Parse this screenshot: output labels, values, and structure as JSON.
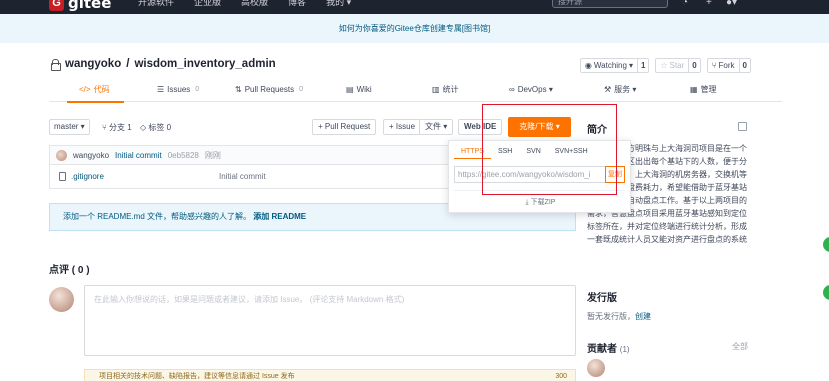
{
  "topbar": {
    "logo_text": "gitee",
    "nav": [
      "开源软件",
      "企业版",
      "高校版",
      "博客",
      "我的 ▾"
    ],
    "search_placeholder": "搜开源"
  },
  "banner": {
    "text": "如何为你喜爱的Gitee仓库创建专属[图书馆]"
  },
  "repo": {
    "owner": "wangyoko",
    "separator": "/",
    "name": "wisdom_inventory_admin",
    "watch_label": "Watching",
    "watch_count": "1",
    "star_label": "Star",
    "star_count": "0",
    "fork_label": "Fork",
    "fork_count": "0"
  },
  "tabs": [
    {
      "label": "代码",
      "icon": "code-icon"
    },
    {
      "label": "Issues",
      "badge": "0"
    },
    {
      "label": "Pull Requests",
      "badge": "0"
    },
    {
      "label": "Wiki"
    },
    {
      "label": "统计"
    },
    {
      "label": "DevOps ▾"
    },
    {
      "label": "服务 ▾"
    },
    {
      "label": "管理"
    }
  ],
  "toolbar": {
    "branch": "master ▾",
    "branches": "分支 1",
    "tags": "标签 0",
    "pull_request": "+ Pull Request",
    "issue": "+ Issue",
    "file": "文件 ▾",
    "webide": "Web IDE",
    "clone": "克隆/下载 ▾"
  },
  "commit": {
    "author": "wangyoko",
    "message": "Initial commit",
    "sha": "0eb5828",
    "time": "刚刚"
  },
  "files": [
    {
      "name": ".gitignore",
      "message": "Initial commit"
    }
  ],
  "readme_notice": {
    "text": "添加一个 README.md 文件，帮助感兴趣的人了解。",
    "action": "添加 README"
  },
  "comments": {
    "title": "点评 ( 0 )",
    "placeholder": "在此输入你想说的话，如果是问题或者建议，请添加 Issue。 (评论支持 Markdown 格式)",
    "notice": "项目相关的技术问题、缺陷报告，建议等信息请通过 Issue 发布",
    "notice_count": "300"
  },
  "clone_popup": {
    "tabs": [
      "HTTPS",
      "SSH",
      "SVN",
      "SVN+SSH"
    ],
    "url": "https://gitee.com/wangyoko/wisdom_i",
    "copy": "复制",
    "zip": "下载ZIP"
  },
  "sidebar": {
    "intro_title": "简介",
    "intro": "系统源于东方明珠与上大海洞司项目是在一个大的生态园区出出每个基站下的人数，便于分入生态园区。上大海洞的机房务器，交换机等设置每年要盘费耗力，希望能借助于蓝牙基站完成资产的自动盘点工作。基于以上两项目的需求，智慧盘点项目采用蓝牙基站感知到定位标签所在，并对定位终端进行统计分析，形成一套既成统计人员又能对资产进行盘点的系统",
    "release_title": "发行版",
    "release_text": "暂无发行版，",
    "release_link": "创建",
    "contrib_title": "贡献者",
    "contrib_count": "(1)",
    "contrib_all": "全部"
  },
  "colors": {
    "accent": "#fe7300",
    "link": "#005980",
    "highlight": "#e0142b"
  }
}
